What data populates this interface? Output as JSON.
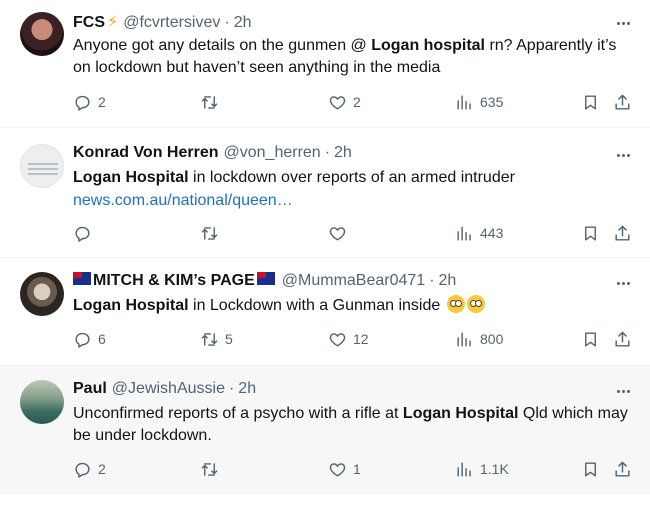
{
  "tweets": [
    {
      "name": "FCS",
      "name_suffix": "⚡",
      "handle": "@fcvrtersivev",
      "time": "2h",
      "text_parts": [
        "Anyone got any details on the gunmen @ ",
        "Logan hospital",
        " rn? Apparently it’s on lockdown but haven’t seen anything in the media"
      ],
      "replies": "2",
      "retweets": "",
      "likes": "2",
      "views": "635"
    },
    {
      "name": "Konrad Von Herren",
      "handle": "@von_herren",
      "time": "2h",
      "text_parts": [
        "Logan Hospital",
        " in lockdown over reports of an armed intruder"
      ],
      "link": "news.com.au/national/queen…",
      "replies": "",
      "retweets": "",
      "likes": "",
      "views": "443"
    },
    {
      "name": "MITCH & KIM’s PAGE",
      "handle": "@MummaBear0471",
      "time": "2h",
      "text_parts": [
        "Logan Hospital",
        " in Lockdown with a Gunman inside"
      ],
      "replies": "6",
      "retweets": "5",
      "likes": "12",
      "views": "800"
    },
    {
      "name": "Paul",
      "handle": "@JewishAussie",
      "time": "2h",
      "text_parts": [
        "Unconfirmed reports of a psycho with a rifle at ",
        "Logan Hospital",
        " Qld which may be under lockdown."
      ],
      "replies": "2",
      "retweets": "",
      "likes": "1",
      "views": "1.1K"
    }
  ],
  "icons": {
    "reply": "reply-icon",
    "retweet": "retweet-icon",
    "like": "heart-icon",
    "views": "views-icon",
    "bookmark": "bookmark-icon",
    "share": "share-icon",
    "more": "more-icon"
  },
  "colors": {
    "text": "#0f1419",
    "muted": "#536471",
    "link": "#1d70c2",
    "highlight_bg": "#f7f7f7"
  }
}
